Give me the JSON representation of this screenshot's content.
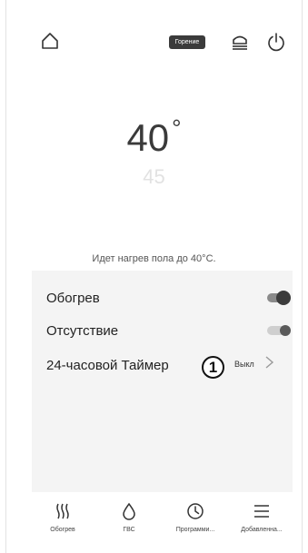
{
  "header": {
    "burn_badge": "Горение",
    "icons": [
      "home-icon",
      "heater-icon",
      "power-icon"
    ]
  },
  "temperature": {
    "current": "40",
    "degree_sign": "°",
    "target": "45"
  },
  "status_text": "Идет нагрев пола до 40°C.",
  "settings": {
    "heating": {
      "label": "Обогрев",
      "on": true
    },
    "absence": {
      "label": "Отсутствие",
      "on": false
    },
    "timer": {
      "label": "24-часовой Таймер",
      "value": "Выкл",
      "callout": "1"
    }
  },
  "nav": {
    "heating": {
      "label": "Обогрев",
      "icon": "heat-waves-icon"
    },
    "hot_water": {
      "label": "ГВС",
      "icon": "water-drop-icon"
    },
    "programs": {
      "label": "Программи...",
      "icon": "clock-icon"
    },
    "added": {
      "label": "Добавленна...",
      "icon": "menu-icon"
    }
  },
  "colors": {
    "badge_bg": "#3b3b3b",
    "panel_bg": "#f4f4f4",
    "target_temp": "#e2e2e2"
  }
}
